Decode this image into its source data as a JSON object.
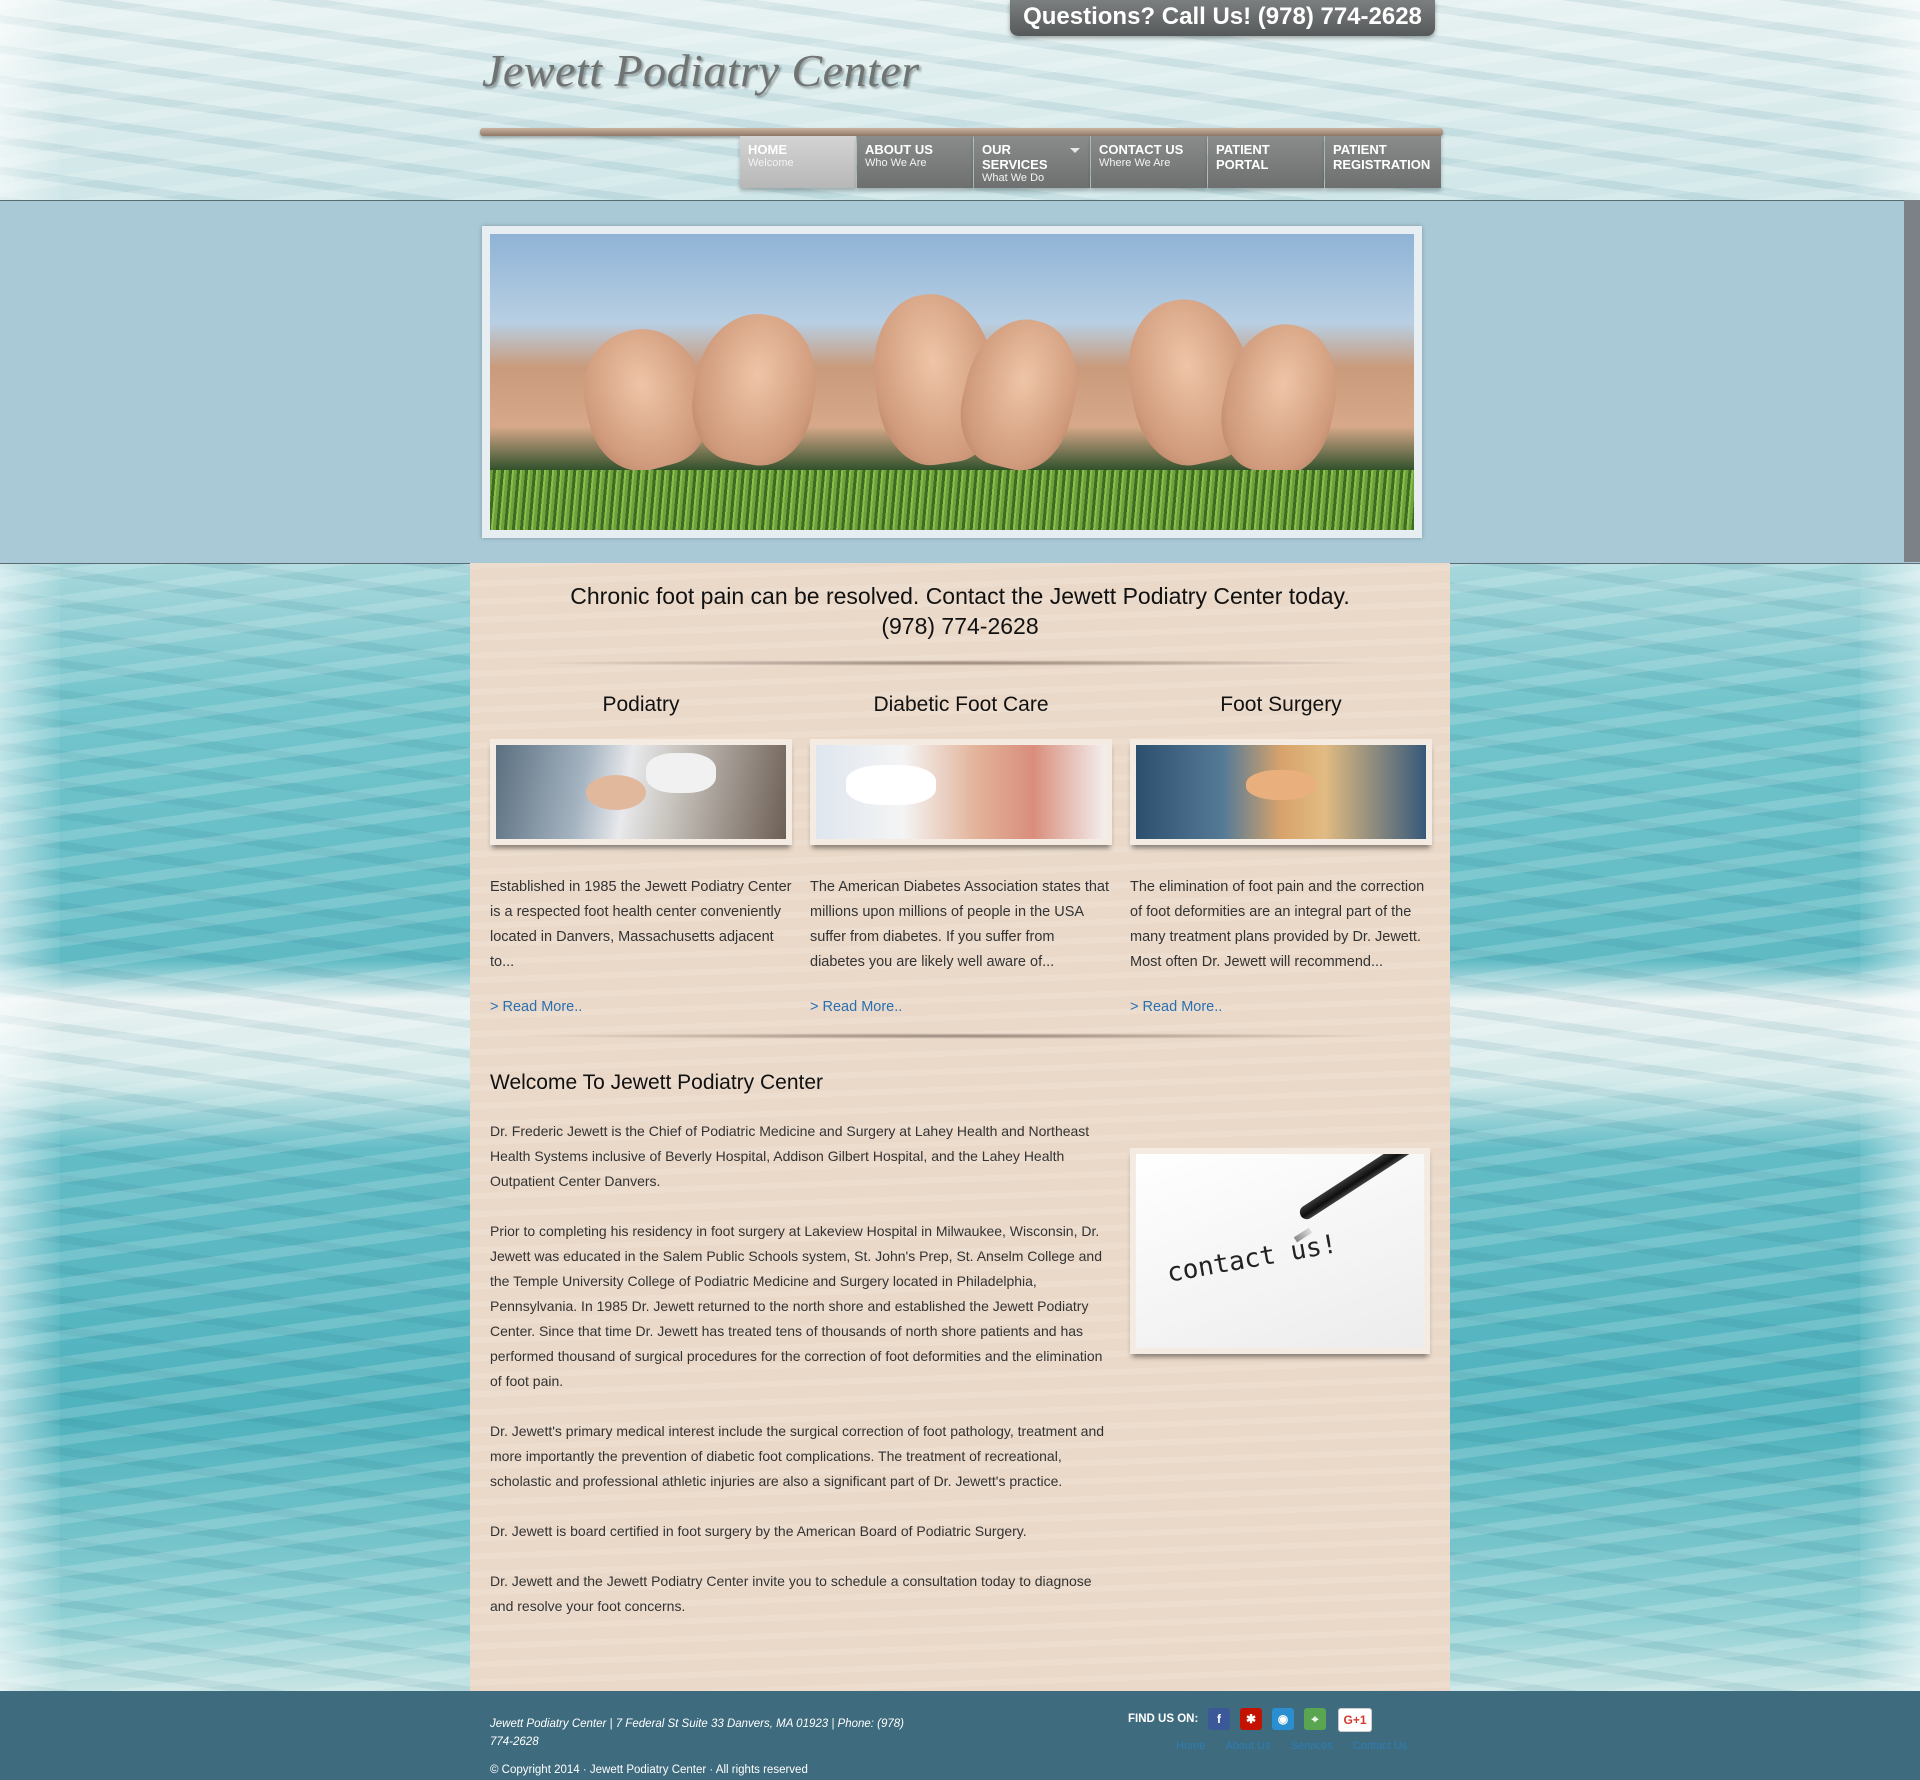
{
  "header": {
    "call_text": "Questions? Call Us! (978) 774-2628",
    "logo": "Jewett Podiatry Center"
  },
  "nav": [
    {
      "title": "HOME",
      "sub": "Welcome"
    },
    {
      "title": "ABOUT US",
      "sub": "Who We Are"
    },
    {
      "title": "OUR SERVICES",
      "sub": "What We Do"
    },
    {
      "title": "CONTACT US",
      "sub": "Where We Are"
    },
    {
      "title": "PATIENT PORTAL",
      "sub": ""
    },
    {
      "title": "PATIENT REGISTRATION",
      "sub": ""
    }
  ],
  "tagline": {
    "line1": "Chronic foot pain can be resolved. Contact the Jewett Podiatry Center today.",
    "line2": "(978) 774-2628"
  },
  "services": [
    {
      "title": "Podiatry",
      "text": "Established in 1985 the Jewett Podiatry Center is a respected foot health center conveniently located in Danvers, Massachusetts adjacent to...",
      "link": "> Read More.."
    },
    {
      "title": "Diabetic Foot Care",
      "text": "The American Diabetes Association states that millions upon millions of people in the USA suffer from diabetes. If you suffer from diabetes you are likely well aware of...",
      "link": "> Read More.."
    },
    {
      "title": "Foot Surgery",
      "text": "The elimination of foot pain and the correction of foot deformities are an integral part of the many treatment plans provided by Dr. Jewett. Most often Dr. Jewett will recommend...",
      "link": "> Read More.."
    }
  ],
  "welcome": {
    "title": "Welcome To Jewett Podiatry Center",
    "paragraphs": [
      "Dr. Frederic Jewett is the Chief of Podiatric Medicine and Surgery at Lahey Health and Northeast Health Systems inclusive of Beverly Hospital, Addison Gilbert Hospital, and the Lahey Health Outpatient Center Danvers.",
      "Prior to completing his residency in foot surgery at Lakeview Hospital in Milwaukee, Wisconsin, Dr. Jewett was educated in the Salem Public Schools system, St. John's Prep, St. Anselm College and the Temple University College of Podiatric Medicine and Surgery located in Philadelphia, Pennsylvania. In 1985 Dr. Jewett returned to the north shore and established the Jewett Podiatry Center. Since that time Dr. Jewett has treated tens of thousands of north shore patients and has performed thousand of surgical procedures for the correction of foot deformities and the elimination of foot pain.",
      "Dr. Jewett's primary medical interest include the surgical correction of foot pathology, treatment and more importantly the prevention of diabetic foot complications. The treatment of recreational, scholastic and professional athletic injuries are also a significant part of Dr. Jewett's practice.",
      "Dr. Jewett is board certified in foot surgery by the American Board of Podiatric Surgery.",
      "Dr. Jewett and the Jewett Podiatry Center invite you to schedule a consultation today to diagnose and resolve your foot concerns."
    ]
  },
  "contact_image_text": "contact us!",
  "footer": {
    "address": "Jewett Podiatry Center | 7 Federal St Suite 33 Danvers, MA 01923 | Phone: (978) 774-2628",
    "copyright": "© Copyright 2014 · Jewett Podiatry Center · All rights reserved",
    "find_us": "FIND US ON:",
    "social": [
      {
        "icon": "facebook-icon",
        "label": "f",
        "color": "#3b5998"
      },
      {
        "icon": "yelp-icon",
        "label": "✱",
        "color": "#c41200"
      },
      {
        "icon": "review-icon",
        "label": "◉",
        "color": "#2a8fd1"
      },
      {
        "icon": "maps-icon",
        "label": "⌖",
        "color": "#5aa650"
      },
      {
        "icon": "google-plus-icon",
        "label": "G+1",
        "color": "#ffffff"
      }
    ],
    "links": [
      "Home",
      "About Us",
      "Services",
      "Contact Us"
    ]
  }
}
